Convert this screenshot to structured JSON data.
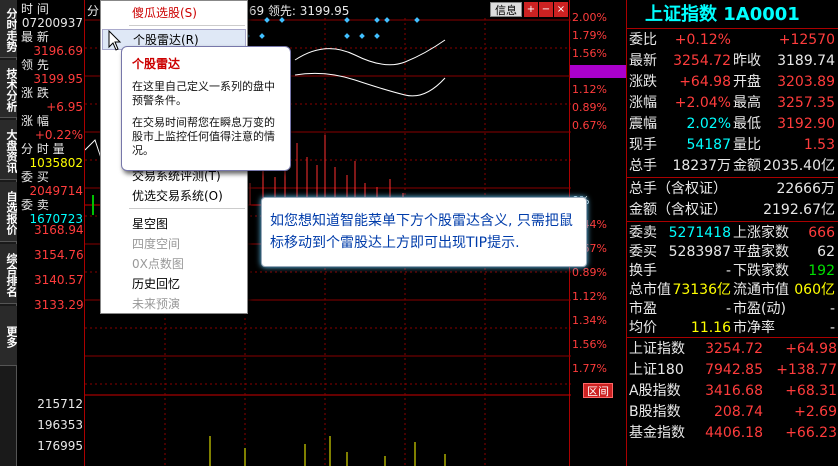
{
  "vtabs": [
    "分时走势",
    "技术分析",
    "大盘资讯",
    "自选报价",
    "综合排名",
    "更多"
  ],
  "left_quote": [
    {
      "t": "时      间",
      "c": "w"
    },
    {
      "t": "07200937",
      "c": "w"
    },
    {
      "t": "最      新",
      "c": "w"
    },
    {
      "t": "3196.69",
      "c": "r"
    },
    {
      "t": "领      先",
      "c": "w"
    },
    {
      "t": "3199.95",
      "c": "r"
    },
    {
      "t": "涨      跌",
      "c": "w"
    },
    {
      "t": "+6.95",
      "c": "r"
    },
    {
      "t": "涨      幅",
      "c": "w"
    },
    {
      "t": "+0.22%",
      "c": "r"
    },
    {
      "t": "分 时 量",
      "c": "w"
    },
    {
      "t": "1035802",
      "c": "y"
    },
    {
      "t": "委      买",
      "c": "w"
    },
    {
      "t": "2049714",
      "c": "r"
    },
    {
      "t": "委      卖",
      "c": "w"
    },
    {
      "t": "1670723",
      "c": "c"
    }
  ],
  "left_scale": [
    "3168.94",
    "3154.76",
    "3140.57",
    "3133.29"
  ],
  "vol_scale": [
    "215712",
    "196353",
    "176995"
  ],
  "chart_header": {
    "prefix": "分时",
    "value": ".69 领先: 3199.95"
  },
  "chart_buttons": {
    "info": "信息",
    "interval": "区间"
  },
  "right_scale_top": [
    "2.00%",
    "1.79%",
    "1.56%",
    "1.42%",
    "1.12%",
    "0.89%",
    "0.67%"
  ],
  "right_scale_bot": [
    "0%",
    "0.44%",
    "0.67%",
    "0.89%",
    "1.12%",
    "1.34%",
    "1.56%",
    "1.77%"
  ],
  "menu": {
    "items": [
      {
        "label": "傻瓜选股(S)",
        "kind": "red"
      },
      {
        "label": "个股雷达(R)",
        "kind": "hot"
      },
      {
        "label": "交易系统评测(T)",
        "kind": "n"
      },
      {
        "label": "优选交易系统(O)",
        "kind": "n"
      },
      {
        "label": "星空图",
        "kind": "n"
      },
      {
        "label": "四度空间",
        "kind": "dis"
      },
      {
        "label": "0X点数图",
        "kind": "dis"
      },
      {
        "label": "历史回忆",
        "kind": "n"
      },
      {
        "label": "未来预演",
        "kind": "dis"
      }
    ]
  },
  "tooltip": {
    "title": "个股雷达",
    "p1": "在这里自己定义一系列的盘中预警条件。",
    "p2": "在交易时间帮您在瞬息万变的股市上监控任何值得注意的情况。"
  },
  "callout": "如您想知道智能菜单下方个股雷达含义, 只需把鼠标移动到个雷股达上方即可出现TIP提示.",
  "right_panel": {
    "title": "上证指数 1A0001",
    "rows": [
      {
        "l": "委比",
        "v1": "+0.12%",
        "v1c": "r",
        "l2": "",
        "v2": "+12570",
        "v2c": "r"
      },
      {
        "l": "最新",
        "v1": "3254.72",
        "v1c": "r",
        "l2": "昨收",
        "v2": "3189.74",
        "v2c": "w"
      },
      {
        "l": "涨跌",
        "v1": "+64.98",
        "v1c": "r",
        "l2": "开盘",
        "v2": "3203.89",
        "v2c": "r"
      },
      {
        "l": "涨幅",
        "v1": "+2.04%",
        "v1c": "r",
        "l2": "最高",
        "v2": "3257.35",
        "v2c": "r"
      },
      {
        "l": "震幅",
        "v1": "2.02%",
        "v1c": "c",
        "l2": "最低",
        "v2": "3192.90",
        "v2c": "r"
      },
      {
        "l": "现手",
        "v1": "54187",
        "v1c": "c",
        "l2": "量比",
        "v2": "1.53",
        "v2c": "r"
      },
      {
        "l": "总手",
        "v1": "18237万",
        "v1c": "w",
        "l2": "金额",
        "v2": "2035.40亿",
        "v2c": "w"
      }
    ],
    "rows2": [
      {
        "l": "总手（含权证）",
        "v": "22666万"
      },
      {
        "l": "金额（含权证）",
        "v": "2192.67亿"
      }
    ],
    "rows3": [
      {
        "l": "委卖",
        "v1": "5271418",
        "v1c": "c",
        "l2": "上涨家数",
        "v2": "666",
        "v2c": "r"
      },
      {
        "l": "委买",
        "v1": "5283987",
        "v1c": "w",
        "l2": "平盘家数",
        "v2": "62",
        "v2c": "w"
      },
      {
        "l": "换手",
        "v1": "-",
        "v1c": "w",
        "l2": "下跌家数",
        "v2": "192",
        "v2c": "g"
      },
      {
        "l": "总市值",
        "v1": "73136亿",
        "v1c": "y",
        "l2": "流通市值",
        "v2": "060亿",
        "v2c": "y"
      },
      {
        "l": "市盈",
        "v1": "-",
        "v1c": "w",
        "l2": "市盈(动)",
        "v2": "-",
        "v2c": "w"
      },
      {
        "l": "均价",
        "v1": "11.16",
        "v1c": "y",
        "l2": "市净率",
        "v2": "-",
        "v2c": "w"
      }
    ],
    "rows4": [
      {
        "l": "上证指数",
        "v1": "3254.72",
        "v2": "+64.98"
      },
      {
        "l": "上证180",
        "v1": "7942.85",
        "v2": "+138.77"
      },
      {
        "l": "A股指数",
        "v1": "3416.68",
        "v2": "+68.31"
      },
      {
        "l": "B股指数",
        "v1": "208.74",
        "v2": "+2.69"
      },
      {
        "l": "基金指数",
        "v1": "4406.18",
        "v2": "+66.23"
      }
    ]
  }
}
